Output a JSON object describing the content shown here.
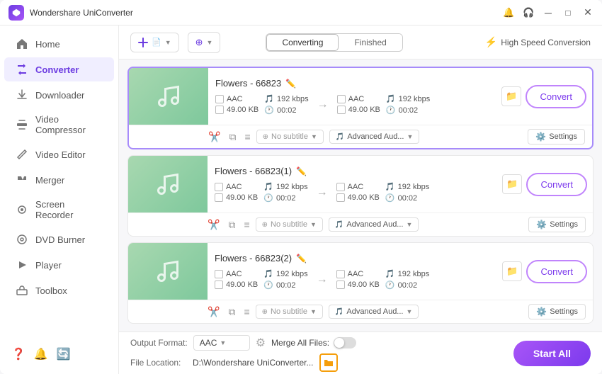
{
  "titleBar": {
    "appName": "Wondershare UniConverter",
    "controls": [
      "–",
      "□",
      "✕"
    ]
  },
  "sidebar": {
    "items": [
      {
        "label": "Home",
        "icon": "home"
      },
      {
        "label": "Converter",
        "icon": "converter",
        "active": true
      },
      {
        "label": "Downloader",
        "icon": "downloader"
      },
      {
        "label": "Video Compressor",
        "icon": "compressor"
      },
      {
        "label": "Video Editor",
        "icon": "editor"
      },
      {
        "label": "Merger",
        "icon": "merger"
      },
      {
        "label": "Screen Recorder",
        "icon": "recorder"
      },
      {
        "label": "DVD Burner",
        "icon": "dvd"
      },
      {
        "label": "Player",
        "icon": "player"
      },
      {
        "label": "Toolbox",
        "icon": "toolbox"
      }
    ]
  },
  "toolbar": {
    "addFileBtn": "+",
    "addFolderBtn": "+",
    "tabs": {
      "converting": "Converting",
      "finished": "Finished"
    },
    "activeTab": "converting",
    "highSpeed": "High Speed Conversion"
  },
  "files": [
    {
      "id": 1,
      "name": "Flowers - 66823",
      "selected": true,
      "inputFormat": "AAC",
      "inputSize": "49.00 KB",
      "inputBitrate": "192 kbps",
      "inputDuration": "00:02",
      "outputFormat": "AAC",
      "outputSize": "49.00 KB",
      "outputBitrate": "192 kbps",
      "outputDuration": "00:02",
      "subtitle": "No subtitle",
      "audio": "Advanced Aud...",
      "convertLabel": "Convert",
      "settingsLabel": "Settings"
    },
    {
      "id": 2,
      "name": "Flowers - 66823(1)",
      "selected": false,
      "inputFormat": "AAC",
      "inputSize": "49.00 KB",
      "inputBitrate": "192 kbps",
      "inputDuration": "00:02",
      "outputFormat": "AAC",
      "outputSize": "49.00 KB",
      "outputBitrate": "192 kbps",
      "outputDuration": "00:02",
      "subtitle": "No subtitle",
      "audio": "Advanced Aud...",
      "convertLabel": "Convert",
      "settingsLabel": "Settings"
    },
    {
      "id": 3,
      "name": "Flowers - 66823(2)",
      "selected": false,
      "inputFormat": "AAC",
      "inputSize": "49.00 KB",
      "inputBitrate": "192 kbps",
      "inputDuration": "00:02",
      "outputFormat": "AAC",
      "outputSize": "49.00 KB",
      "outputBitrate": "192 kbps",
      "outputDuration": "00:02",
      "subtitle": "No subtitle",
      "audio": "Advanced Aud...",
      "convertLabel": "Convert",
      "settingsLabel": "Settings"
    }
  ],
  "bottomBar": {
    "outputFormatLabel": "Output Format:",
    "outputFormat": "AAC",
    "fileLocationLabel": "File Location:",
    "fileLocation": "D:\\Wondershare UniConverter...",
    "mergeLabel": "Merge All Files:",
    "startAllLabel": "Start All"
  }
}
